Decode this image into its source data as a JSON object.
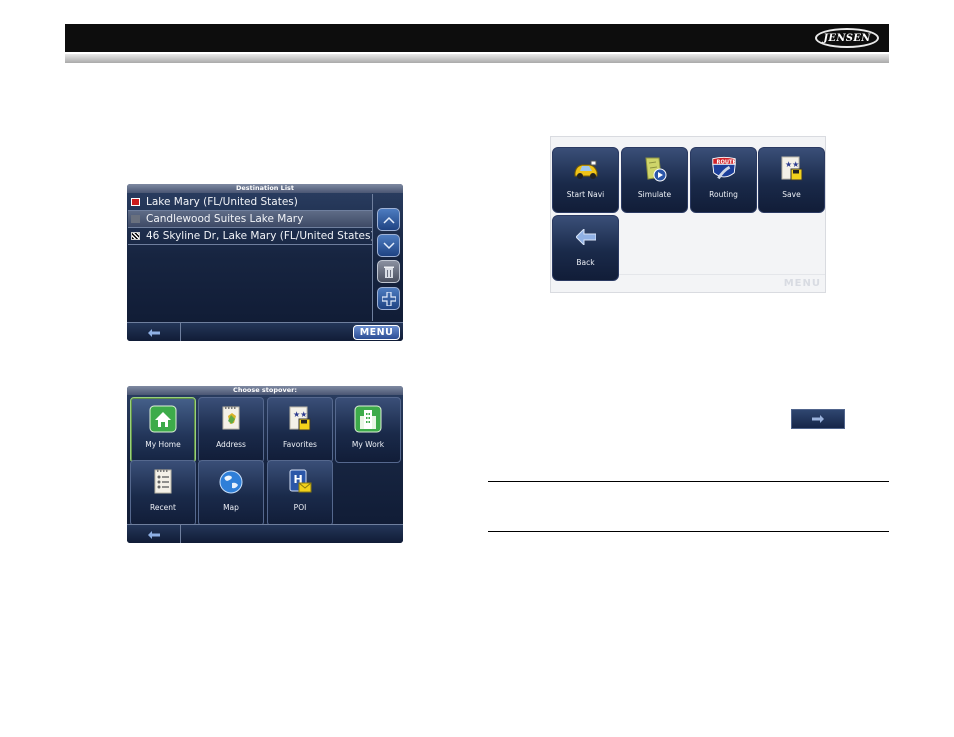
{
  "header": {
    "brand": "JENSEN"
  },
  "destination_list": {
    "title": "Destination List",
    "rows": [
      {
        "text": "Lake Mary (FL/United States)",
        "marker": "start"
      },
      {
        "text": "Candlewood Suites Lake Mary",
        "marker": "via"
      },
      {
        "text": "46 Skyline Dr, Lake Mary (FL/United States)",
        "marker": "destination"
      }
    ],
    "side_icons": [
      "up-arrow-icon",
      "down-arrow-icon",
      "trash-icon",
      "plus-icon"
    ],
    "menu_label": "MENU"
  },
  "stopover": {
    "title": "Choose stopover:",
    "tiles": [
      {
        "label": "My Home",
        "icon": "home-icon"
      },
      {
        "label": "Address",
        "icon": "address-book-icon"
      },
      {
        "label": "Favorites",
        "icon": "favorites-icon"
      },
      {
        "label": "My Work",
        "icon": "office-building-icon"
      },
      {
        "label": "Recent",
        "icon": "recent-list-icon"
      },
      {
        "label": "Map",
        "icon": "globe-icon"
      },
      {
        "label": "POI",
        "icon": "poi-icon"
      }
    ]
  },
  "route_menu": {
    "tiles": [
      {
        "label": "Start Navi",
        "icon": "car-icon"
      },
      {
        "label": "Simulate",
        "icon": "simulate-icon"
      },
      {
        "label": "Routing",
        "icon": "route-sign-icon"
      },
      {
        "label": "Save",
        "icon": "save-icon"
      },
      {
        "label": "Back",
        "icon": "back-arrow-icon"
      }
    ],
    "ghost_menu_label": "MENU"
  },
  "colors": {
    "screen_bg": "#172541",
    "highlight_border": "#9ad17c",
    "menu_button": "#2c4e94"
  }
}
